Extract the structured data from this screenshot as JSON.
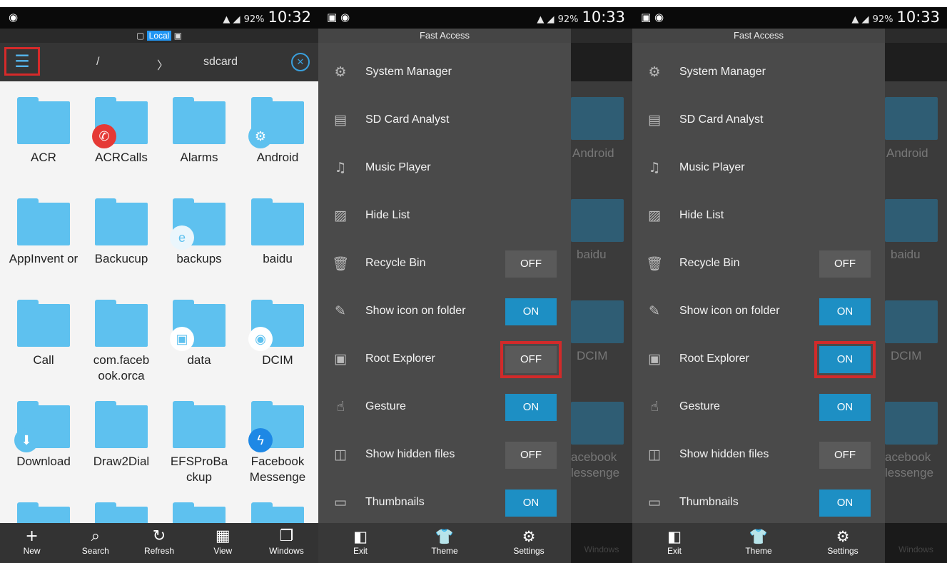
{
  "panel1": {
    "status": {
      "time": "10:32",
      "battery": "92%"
    },
    "location_tag": "Local",
    "breadcrumb": [
      "/",
      "〉",
      "sdcard"
    ],
    "folders": [
      {
        "name": "ACR"
      },
      {
        "name": "ACRCalls",
        "badge": "phone-icon"
      },
      {
        "name": "Alarms"
      },
      {
        "name": "Android",
        "badge": "gear-icon"
      },
      {
        "name": "AppInvent or"
      },
      {
        "name": "Backucup"
      },
      {
        "name": "backups",
        "badge": "es-icon"
      },
      {
        "name": "baidu"
      },
      {
        "name": "Call"
      },
      {
        "name": "com.faceb ook.orca"
      },
      {
        "name": "data",
        "badge": "image-icon"
      },
      {
        "name": "DCIM",
        "badge": "camera-icon"
      },
      {
        "name": "Download",
        "badge": "download-icon"
      },
      {
        "name": "Draw2Dial"
      },
      {
        "name": "EFSProBa ckup"
      },
      {
        "name": "Facebook Messenge",
        "badge": "messenger-icon"
      }
    ],
    "bottom_nav": [
      {
        "label": "New",
        "icon": "+"
      },
      {
        "label": "Search",
        "icon": "⌕"
      },
      {
        "label": "Refresh",
        "icon": "↻"
      },
      {
        "label": "View",
        "icon": "▦"
      },
      {
        "label": "Windows",
        "icon": "❐"
      }
    ]
  },
  "drawer": {
    "title": "Fast Access",
    "items": [
      {
        "label": "System Manager",
        "icon": "⚙"
      },
      {
        "label": "SD Card Analyst",
        "icon": "▤"
      },
      {
        "label": "Music Player",
        "icon": "♫"
      },
      {
        "label": "Hide List",
        "icon": "▨"
      },
      {
        "label": "Recycle Bin",
        "icon": "🗑"
      },
      {
        "label": "Show icon on folder",
        "icon": "✎"
      },
      {
        "label": "Root Explorer",
        "icon": "▣"
      },
      {
        "label": "Gesture",
        "icon": "☝"
      },
      {
        "label": "Show hidden files",
        "icon": "◫"
      },
      {
        "label": "Thumbnails",
        "icon": "▭"
      }
    ],
    "bottom": [
      {
        "label": "Exit",
        "icon": "◧"
      },
      {
        "label": "Theme",
        "icon": "👕"
      },
      {
        "label": "Settings",
        "icon": "⚙"
      }
    ]
  },
  "panel2": {
    "status": {
      "time": "10:33",
      "battery": "92%"
    },
    "toggles": [
      "",
      "",
      "",
      "",
      "OFF",
      "ON",
      "OFF",
      "ON",
      "OFF",
      "ON"
    ]
  },
  "panel3": {
    "status": {
      "time": "10:33",
      "battery": "92%"
    },
    "toggles": [
      "",
      "",
      "",
      "",
      "OFF",
      "ON",
      "ON",
      "ON",
      "OFF",
      "ON"
    ]
  },
  "dim_labels": [
    "Android",
    "baidu",
    "DCIM",
    "acebook",
    "lessenge"
  ],
  "colors": {
    "accent": "#1d8fc4",
    "folder": "#5ec1ef",
    "highlight": "#d22a2a"
  }
}
